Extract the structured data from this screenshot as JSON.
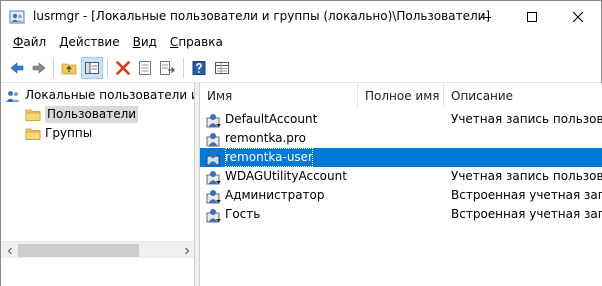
{
  "window": {
    "title": "lusrmgr - [Локальные пользователи и группы (локально)\\Пользователи]",
    "app_icon": "users-app-icon"
  },
  "menu": [
    {
      "label": "Файл",
      "accel_index": 0
    },
    {
      "label": "Действие",
      "accel_index": 0
    },
    {
      "label": "Вид",
      "accel_index": 0
    },
    {
      "label": "Справка",
      "accel_index": 0
    }
  ],
  "toolbar": {
    "buttons": [
      "back-icon",
      "forward-icon",
      "up-folder-icon",
      "show-tree-icon",
      "delete-icon",
      "properties-icon",
      "export-icon",
      "help-icon",
      "details-icon"
    ]
  },
  "tree": {
    "root": "Локальные пользователи и гру",
    "children": [
      "Пользователи",
      "Группы"
    ],
    "selected": "Пользователи"
  },
  "list": {
    "columns": [
      "Имя",
      "Полное имя",
      "Описание"
    ],
    "rows": [
      {
        "name": "DefaultAccount",
        "full_name": "",
        "description": "Учетная запись пользовате"
      },
      {
        "name": "remontka.pro",
        "full_name": "",
        "description": ""
      },
      {
        "name": "remontka-user",
        "full_name": "",
        "description": ""
      },
      {
        "name": "WDAGUtilityAccount",
        "full_name": "",
        "description": "Учетная запись пользовате"
      },
      {
        "name": "Администратор",
        "full_name": "",
        "description": "Встроенная учетная запись"
      },
      {
        "name": "Гость",
        "full_name": "",
        "description": "Встроенная учетная запись"
      }
    ],
    "selected_row": "remontka-user"
  },
  "colors": {
    "selection": "#0078d7",
    "tree_selection": "#d9d9d9",
    "folder": "#f3c75a"
  }
}
